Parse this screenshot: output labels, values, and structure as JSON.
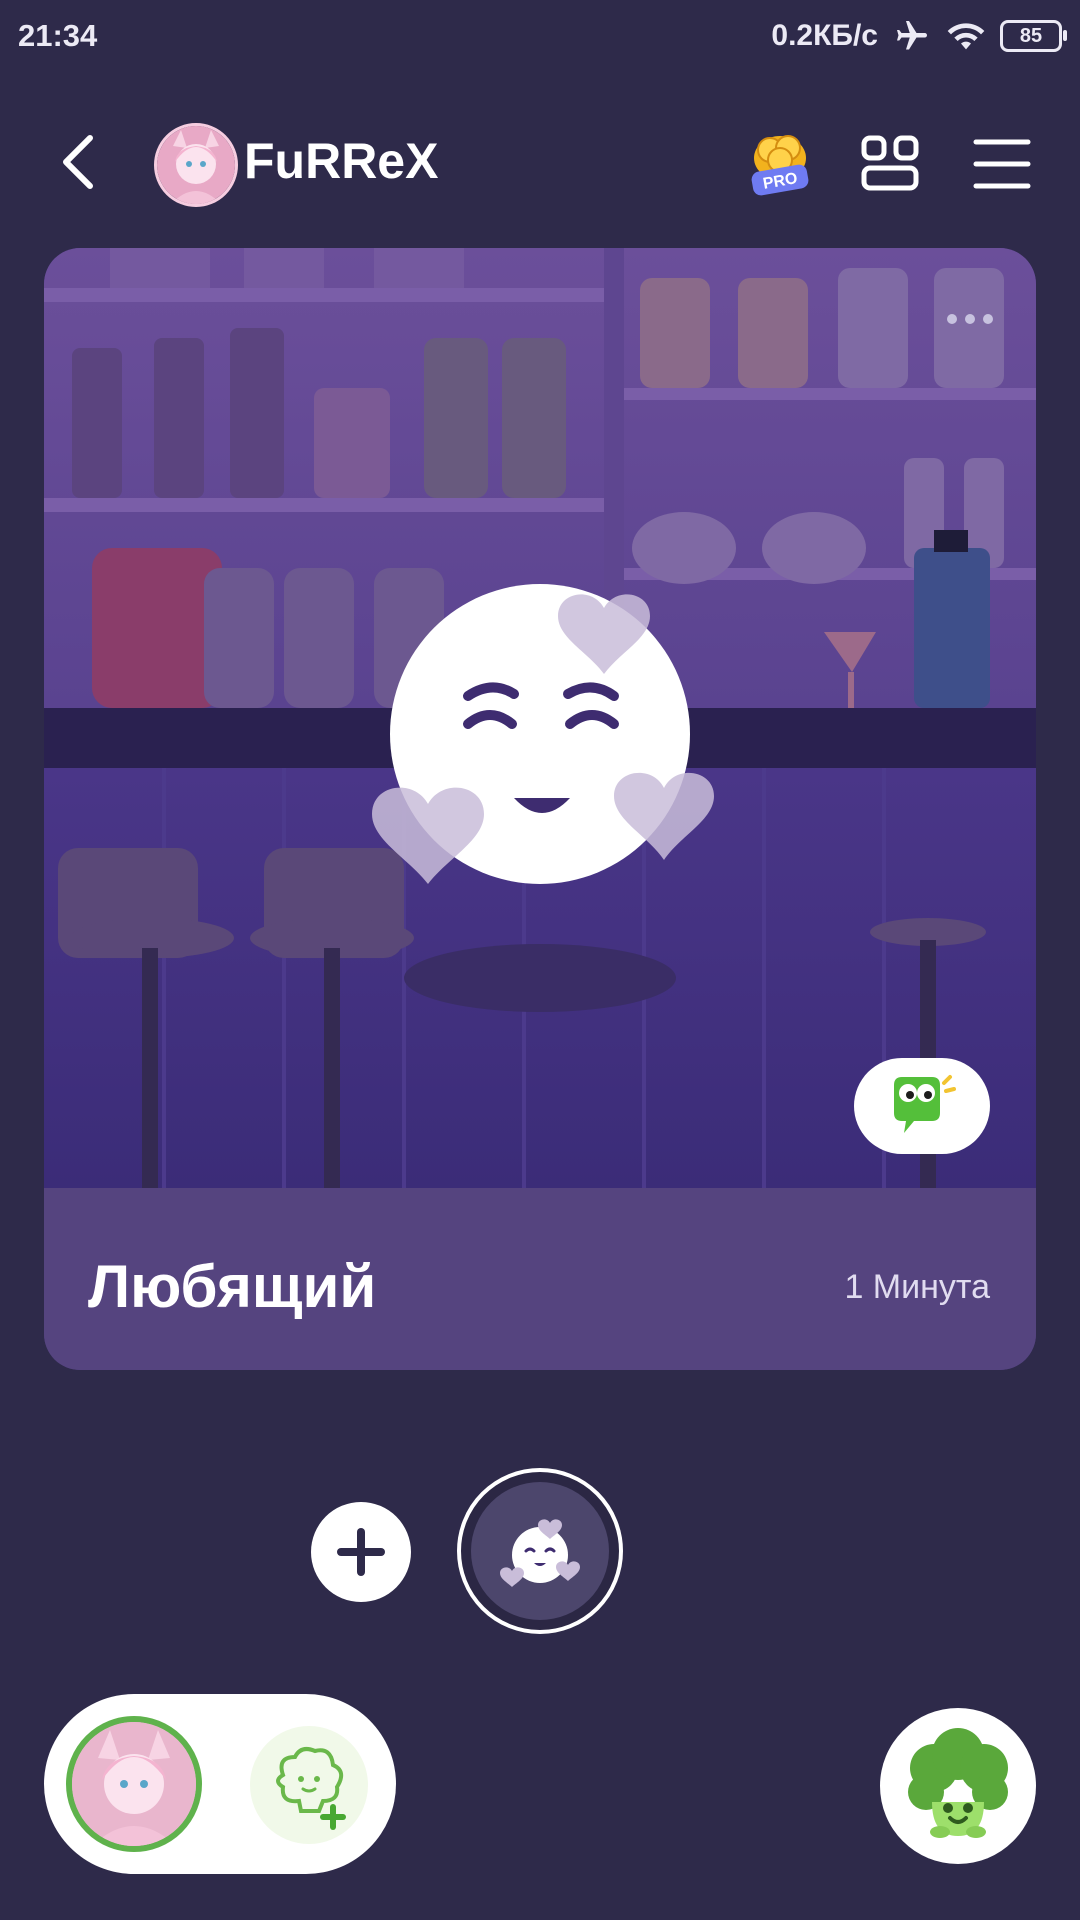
{
  "status_bar": {
    "time": "21:34",
    "net_speed": "0.2КБ/с",
    "battery": "85",
    "icons": [
      "airplane-icon",
      "wifi-icon",
      "battery-icon"
    ]
  },
  "header": {
    "profile_name": "FuRReX",
    "pro_label": "PRO",
    "icons": [
      "back-arrow-icon",
      "pro-coins-icon",
      "grid-icon",
      "menu-icon"
    ]
  },
  "scene": {
    "mood_title": "Любящий",
    "duration": "1 Минута",
    "icons": [
      "more-dots-icon",
      "loving-face-icon",
      "chat-bubble-icon"
    ]
  },
  "mood_picker": {
    "icons": [
      "plus-icon",
      "loving-face-icon"
    ]
  },
  "bottom_bar": {
    "icons": [
      "friend-avatar",
      "add-friend-icon",
      "broccoli-mascot-icon"
    ]
  },
  "colors": {
    "background": "#2e2a4a",
    "card": "#4b3b80",
    "accent_green": "#5fb24c"
  }
}
